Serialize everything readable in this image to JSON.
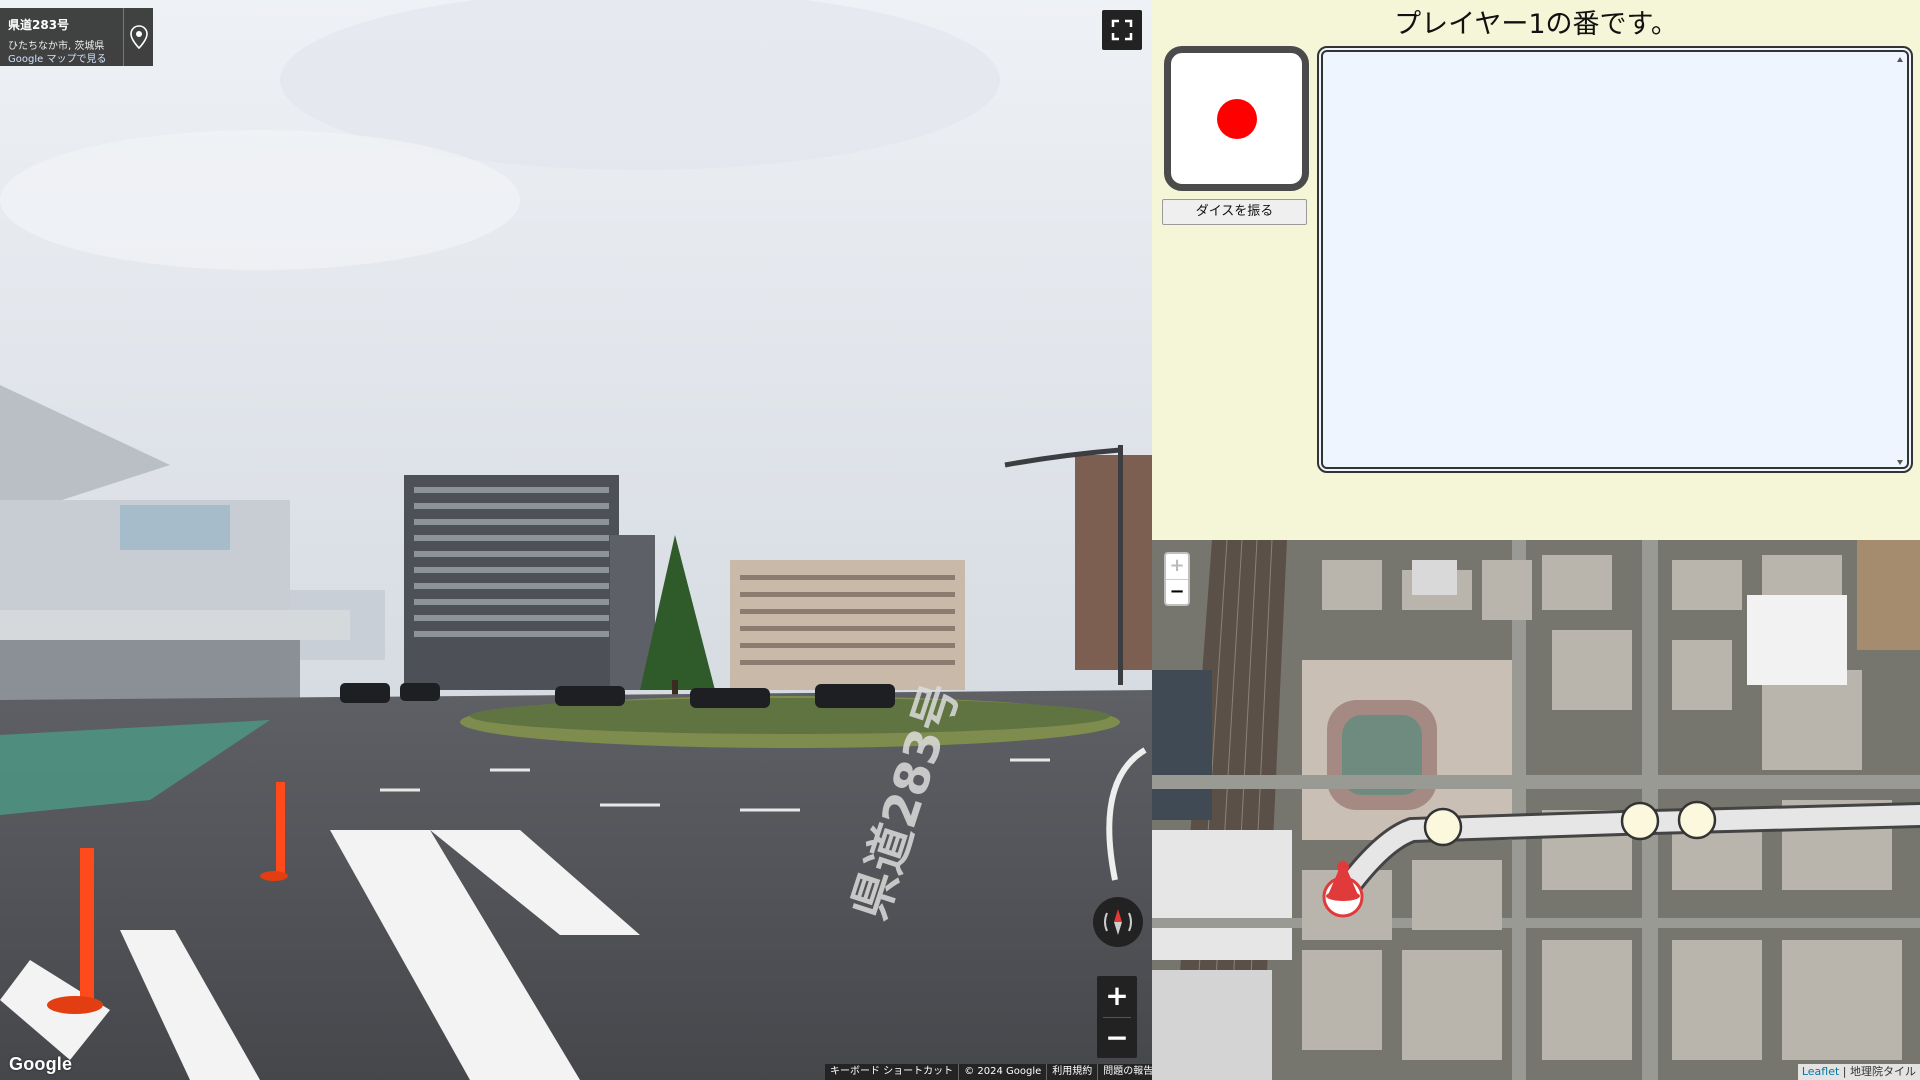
{
  "street_view": {
    "road_name": "県道283号",
    "location": "ひたちなか市, 茨城県",
    "maps_link": "Google マップで見る",
    "google_logo": "Google",
    "footer": [
      "キーボード ショートカット",
      "© 2024 Google",
      "利用規約",
      "問題の報告"
    ],
    "zoom_in": "+",
    "zoom_out": "−",
    "road_marking": "県道283号"
  },
  "game": {
    "turn_message": "プレイヤー1の番です。",
    "dice_color": "#ff0000",
    "roll_button": "ダイスを振る",
    "log_text": ""
  },
  "map": {
    "zoom_in": "+",
    "zoom_out": "−",
    "attribution_link": "Leaflet",
    "attribution_sep": " | ",
    "attribution_tiles": "地理院タイル"
  },
  "colors": {
    "panel_bg": "#f5f5d8",
    "log_bg": "#eef5ff",
    "route": "#e6e6e6",
    "player_marker": "#e03a3a"
  }
}
